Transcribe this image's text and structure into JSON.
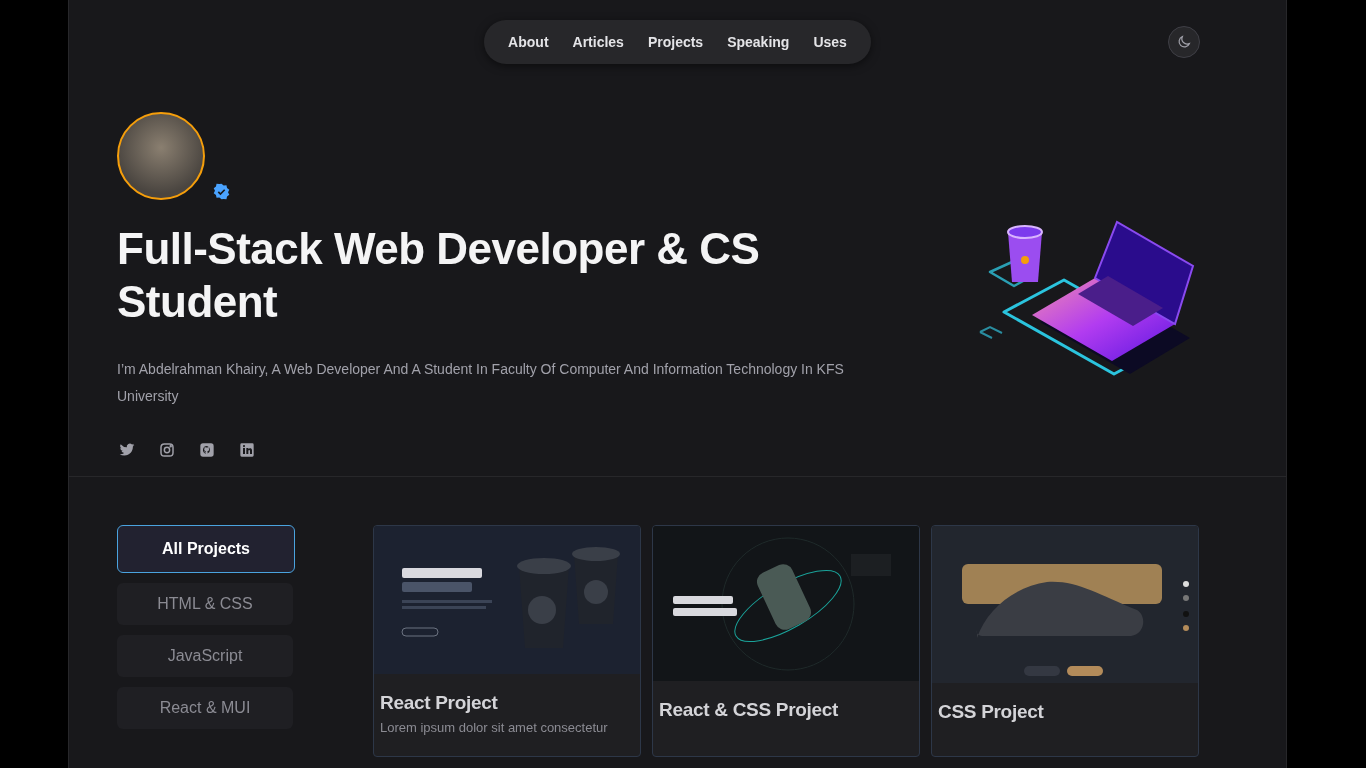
{
  "nav": {
    "links": [
      {
        "label": "About",
        "selected": false
      },
      {
        "label": "Articles",
        "selected": false
      },
      {
        "label": "Projects",
        "selected": false
      },
      {
        "label": "Speaking",
        "selected": false
      },
      {
        "label": "Uses",
        "selected": false
      }
    ]
  },
  "hero": {
    "verified": true,
    "title": "Full-Stack Web Developer & CS Student",
    "bio": "I’m Abdelrahman Khairy, A Web Developer And A Student In Faculty Of Computer And Information Technology In KFS University",
    "socials": [
      {
        "kind": "twitter"
      },
      {
        "kind": "instagram"
      },
      {
        "kind": "github"
      },
      {
        "kind": "linkedin"
      }
    ]
  },
  "filters": [
    {
      "label": "All Projects",
      "selected": true
    },
    {
      "label": "HTML & CSS",
      "selected": false
    },
    {
      "label": "JavaScript",
      "selected": false
    },
    {
      "label": "React & MUI",
      "selected": false
    }
  ],
  "projects": [
    {
      "kind": "coffee",
      "title": "React Project",
      "description": "Lorem ipsum dolor sit amet consectetur"
    },
    {
      "kind": "can",
      "title": "React & CSS Project"
    },
    {
      "kind": "shoe",
      "title": "CSS Project"
    }
  ]
}
